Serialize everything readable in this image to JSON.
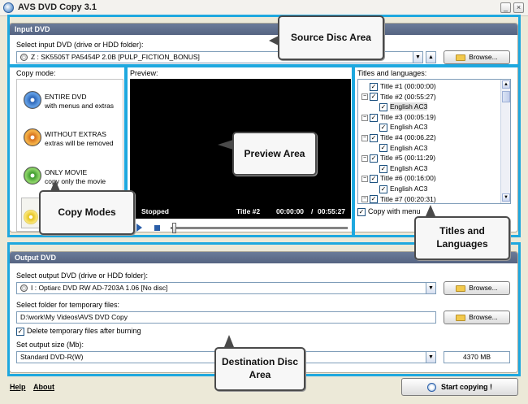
{
  "window": {
    "title": "AVS DVD Copy 3.1",
    "minimize": "_",
    "close": "×"
  },
  "input_dvd": {
    "header": "Input DVD",
    "select_label": "Select input DVD (drive or HDD folder):",
    "drive_value": "Z : SK5505T  PA5454P          2.0B       [PULP_FICTION_BONUS]",
    "browse_label": "Browse...",
    "eject_symbol": "▲"
  },
  "copy_mode": {
    "label": "Copy mode:",
    "options": [
      {
        "title": "ENTIRE DVD",
        "subtitle": "with menus and extras"
      },
      {
        "title": "WITHOUT EXTRAS",
        "subtitle": "extras will be removed"
      },
      {
        "title": "ONLY MOVIE",
        "subtitle": "copy only the movie"
      }
    ]
  },
  "preview": {
    "label": "Preview:",
    "status": "Stopped",
    "title": "Title #2",
    "time_current": "00:00:00",
    "time_separator": "/",
    "time_total": "00:55:27"
  },
  "titles": {
    "label": "Titles and languages:",
    "items": [
      {
        "title": "Title #1 (00:00:00)",
        "language": ""
      },
      {
        "title": "Title #2 (00:55:27)",
        "language": "English AC3"
      },
      {
        "title": "Title #3 (00:05:19)",
        "language": "English AC3"
      },
      {
        "title": "Title #4 (00:06.22)",
        "language": "English AC3"
      },
      {
        "title": "Title #5 (00:11:29)",
        "language": "English AC3"
      },
      {
        "title": "Title #6 (00:16:00)",
        "language": "English AC3"
      },
      {
        "title": "Title #7 (00:20:31)",
        "language": ""
      }
    ],
    "copy_with_menu": "Copy with menu"
  },
  "output_dvd": {
    "header": "Output DVD",
    "select_label": "Select output DVD (drive or HDD folder):",
    "drive_value": "I : Optiarc  DVD RW AD-7203A  1.06        [No disc]",
    "browse_label": "Browse...",
    "temp_label": "Select folder for temporary files:",
    "temp_value": "D:\\work\\My Videos\\AVS DVD Copy",
    "temp_browse": "Browse...",
    "delete_temp": "Delete temporary files after burning",
    "size_label": "Set output size (Mb):",
    "size_value": "Standard DVD-R(W)",
    "size_mb": "4370 MB"
  },
  "footer": {
    "help": "Help",
    "about": "About",
    "start": "Start copying !"
  },
  "annotations": {
    "source": "Source Disc Area",
    "preview": "Preview Area",
    "copy_modes": "Copy Modes",
    "titles": "Titles and Languages",
    "destination": "Destination Disc Area"
  },
  "colors": {
    "highlight": "#1ea8df",
    "header": "#6b7b99",
    "window": "#ece9d8"
  }
}
